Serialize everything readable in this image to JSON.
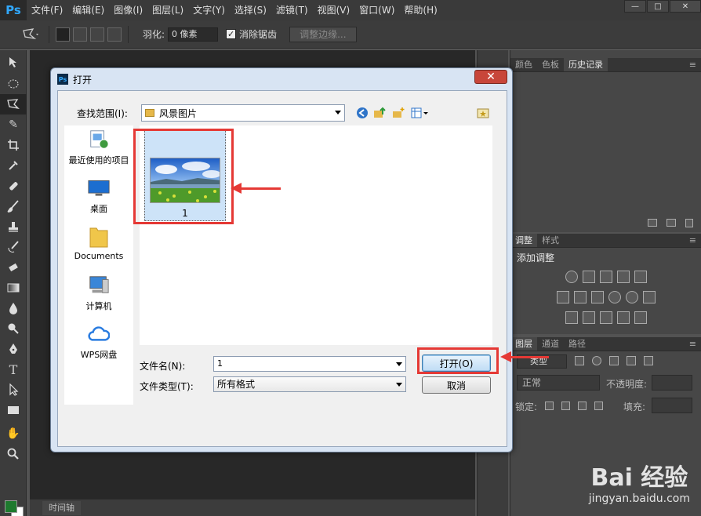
{
  "app": {
    "logo": "Ps",
    "menu": [
      "文件(F)",
      "编辑(E)",
      "图像(I)",
      "图层(L)",
      "文字(Y)",
      "选择(S)",
      "滤镜(T)",
      "视图(V)",
      "窗口(W)",
      "帮助(H)"
    ],
    "window_controls": [
      "—",
      "□",
      "✕"
    ]
  },
  "options_bar": {
    "feather_label": "羽化:",
    "feather_value": "0 像素",
    "antialias_label": "消除锯齿",
    "refine_edge_label": "调整边缘..."
  },
  "panels": {
    "top_tabs": [
      "颜色",
      "色板",
      "历史记录"
    ],
    "middle_tabs": [
      "调整",
      "样式"
    ],
    "add_adjustment": "添加调整",
    "layers_tabs": [
      "图层",
      "通道",
      "路径"
    ],
    "kind_label": "类型",
    "blend_mode": "正常",
    "opacity_label": "不透明度:",
    "lock_label": "锁定:",
    "fill_label": "填充:"
  },
  "timeline": {
    "tab": "时间轴"
  },
  "dialog": {
    "title": "打开",
    "close_glyph": "✕",
    "look_in_label": "查找范围(I):",
    "look_in_value": "风景图片",
    "places": [
      {
        "label": "最近使用的项目",
        "icon": "recent-items-icon"
      },
      {
        "label": "桌面",
        "icon": "desktop-icon"
      },
      {
        "label": "Documents",
        "icon": "documents-folder-icon"
      },
      {
        "label": "计算机",
        "icon": "computer-icon"
      },
      {
        "label": "WPS网盘",
        "icon": "wps-cloud-icon"
      }
    ],
    "files": [
      {
        "name": "1"
      }
    ],
    "filename_label": "文件名(N):",
    "filename_value": "1",
    "filetype_label": "文件类型(T):",
    "filetype_value": "所有格式",
    "open_button": "打开(O)",
    "cancel_button": "取消"
  },
  "watermark": {
    "logo": "Bai 经验",
    "url": "jingyan.baidu.com"
  },
  "colors": {
    "accent": "#31a8ff",
    "annotation": "#e53935"
  }
}
